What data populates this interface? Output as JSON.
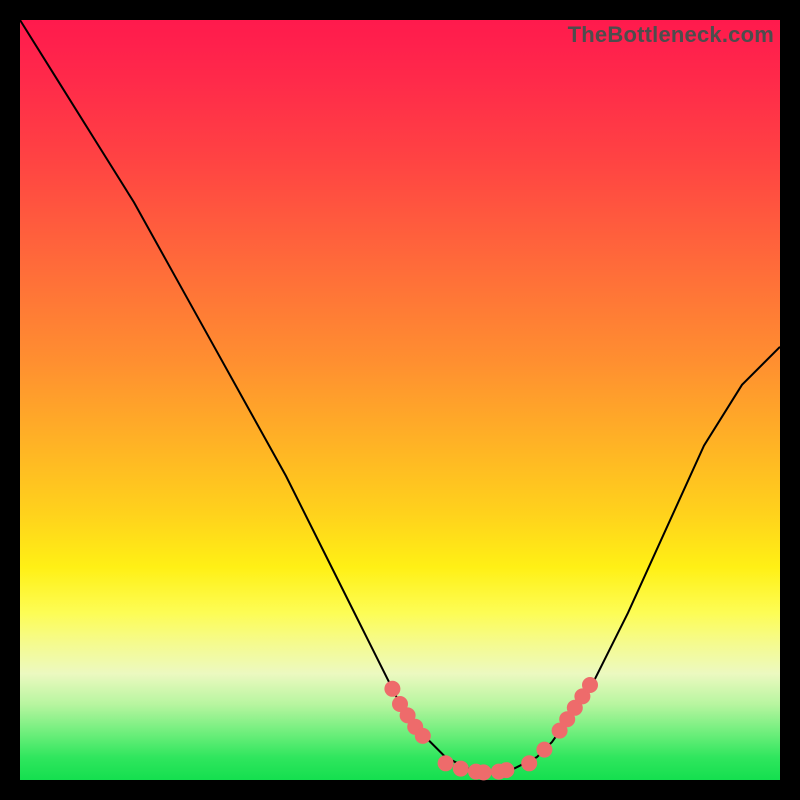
{
  "watermark": "TheBottleneck.com",
  "colors": {
    "background": "#000000",
    "curve": "#000000",
    "marker": "#ee6b6b",
    "gradient_top": "#ff1a4d",
    "gradient_bottom": "#14df4f"
  },
  "chart_data": {
    "type": "line",
    "title": "",
    "xlabel": "",
    "ylabel": "",
    "xlim": [
      0,
      100
    ],
    "ylim": [
      0,
      100
    ],
    "x": [
      0,
      5,
      10,
      15,
      20,
      25,
      30,
      35,
      40,
      45,
      50,
      52,
      54,
      56,
      58,
      60,
      62,
      64,
      66,
      68,
      70,
      75,
      80,
      85,
      90,
      95,
      100
    ],
    "values": [
      100,
      92,
      84,
      76,
      67,
      58,
      49,
      40,
      30,
      20,
      10,
      7,
      5,
      3,
      2,
      1,
      1,
      1,
      2,
      3,
      5,
      12,
      22,
      33,
      44,
      52,
      57
    ],
    "series": [
      {
        "name": "bottleneck-curve",
        "x": [
          0,
          5,
          10,
          15,
          20,
          25,
          30,
          35,
          40,
          45,
          50,
          52,
          54,
          56,
          58,
          60,
          62,
          64,
          66,
          68,
          70,
          75,
          80,
          85,
          90,
          95,
          100
        ],
        "y": [
          100,
          92,
          84,
          76,
          67,
          58,
          49,
          40,
          30,
          20,
          10,
          7,
          5,
          3,
          2,
          1,
          1,
          1,
          2,
          3,
          5,
          12,
          22,
          33,
          44,
          52,
          57
        ]
      }
    ],
    "markers": {
      "name": "highlighted-points",
      "color": "#ee6b6b",
      "points": [
        {
          "x": 49,
          "y": 12
        },
        {
          "x": 50,
          "y": 10
        },
        {
          "x": 51,
          "y": 8.5
        },
        {
          "x": 52,
          "y": 7
        },
        {
          "x": 53,
          "y": 5.8
        },
        {
          "x": 56,
          "y": 2.2
        },
        {
          "x": 58,
          "y": 1.5
        },
        {
          "x": 60,
          "y": 1.1
        },
        {
          "x": 61,
          "y": 1
        },
        {
          "x": 63,
          "y": 1.1
        },
        {
          "x": 64,
          "y": 1.3
        },
        {
          "x": 67,
          "y": 2.2
        },
        {
          "x": 69,
          "y": 4
        },
        {
          "x": 71,
          "y": 6.5
        },
        {
          "x": 72,
          "y": 8
        },
        {
          "x": 73,
          "y": 9.5
        },
        {
          "x": 74,
          "y": 11
        },
        {
          "x": 75,
          "y": 12.5
        }
      ]
    }
  }
}
